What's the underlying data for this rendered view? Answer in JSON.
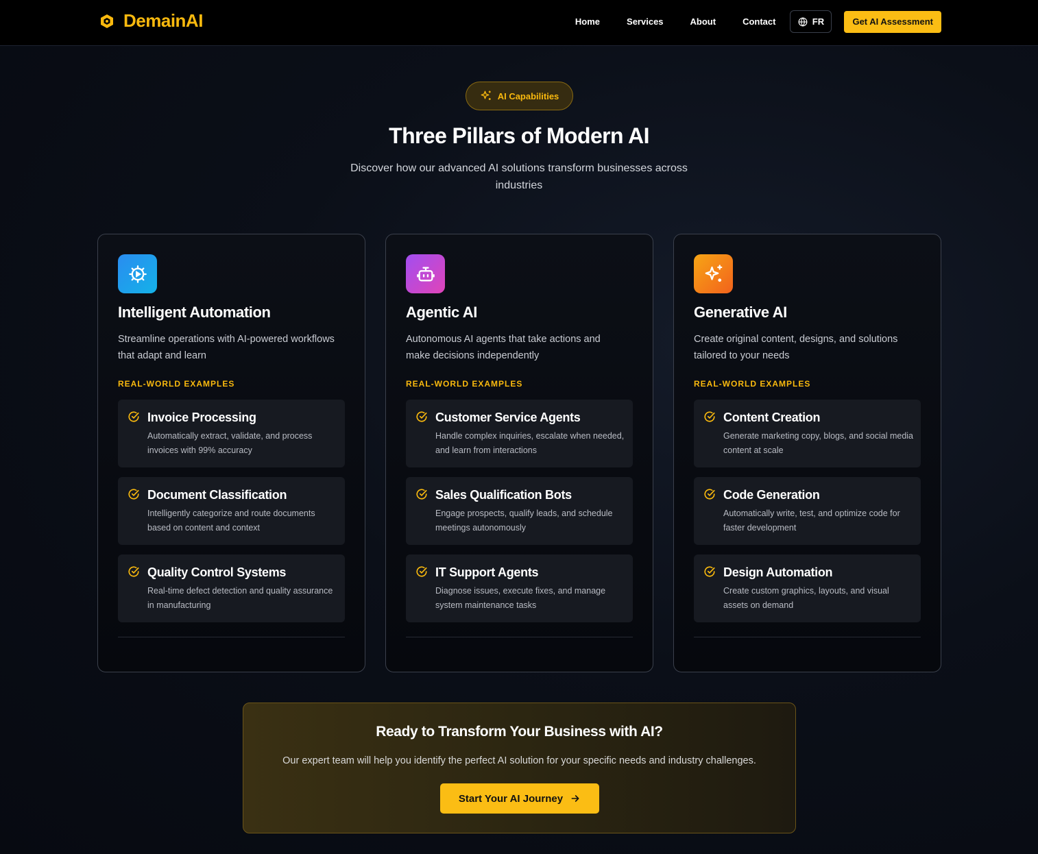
{
  "header": {
    "brand": "DemainAI",
    "nav": [
      "Home",
      "Services",
      "About",
      "Contact"
    ],
    "language": "FR",
    "cta": "Get AI Assessment"
  },
  "hero": {
    "badge": "AI Capabilities",
    "title": "Three Pillars of Modern AI",
    "subtitle": "Discover how our advanced AI solutions transform businesses across industries"
  },
  "cards": [
    {
      "icon": "gear-play-icon",
      "title": "Intelligent Automation",
      "description": "Streamline operations with AI-powered workflows that adapt and learn",
      "label": "REAL-WORLD EXAMPLES",
      "examples": [
        {
          "title": "Invoice Processing",
          "desc": "Automatically extract, validate, and process invoices with 99% accuracy"
        },
        {
          "title": "Document Classification",
          "desc": "Intelligently categorize and route documents based on content and context"
        },
        {
          "title": "Quality Control Systems",
          "desc": "Real-time defect detection and quality assurance in manufacturing"
        }
      ]
    },
    {
      "icon": "robot-icon",
      "title": "Agentic AI",
      "description": "Autonomous AI agents that take actions and make decisions independently",
      "label": "REAL-WORLD EXAMPLES",
      "examples": [
        {
          "title": "Customer Service Agents",
          "desc": "Handle complex inquiries, escalate when needed, and learn from interactions"
        },
        {
          "title": "Sales Qualification Bots",
          "desc": "Engage prospects, qualify leads, and schedule meetings autonomously"
        },
        {
          "title": "IT Support Agents",
          "desc": "Diagnose issues, execute fixes, and manage system maintenance tasks"
        }
      ]
    },
    {
      "icon": "sparkles-icon",
      "title": "Generative AI",
      "description": "Create original content, designs, and solutions tailored to your needs",
      "label": "REAL-WORLD EXAMPLES",
      "examples": [
        {
          "title": "Content Creation",
          "desc": "Generate marketing copy, blogs, and social media content at scale"
        },
        {
          "title": "Code Generation",
          "desc": "Automatically write, test, and optimize code for faster development"
        },
        {
          "title": "Design Automation",
          "desc": "Create custom graphics, layouts, and visual assets on demand"
        }
      ]
    }
  ],
  "cta_section": {
    "title": "Ready to Transform Your Business with AI?",
    "subtitle": "Our expert team will help you identify the perfect AI solution for your specific needs and industry challenges.",
    "button": "Start Your AI Journey"
  },
  "colors": {
    "accent": "#fbbd14",
    "background": "#0b0f18",
    "card_border": "#3b404c"
  }
}
